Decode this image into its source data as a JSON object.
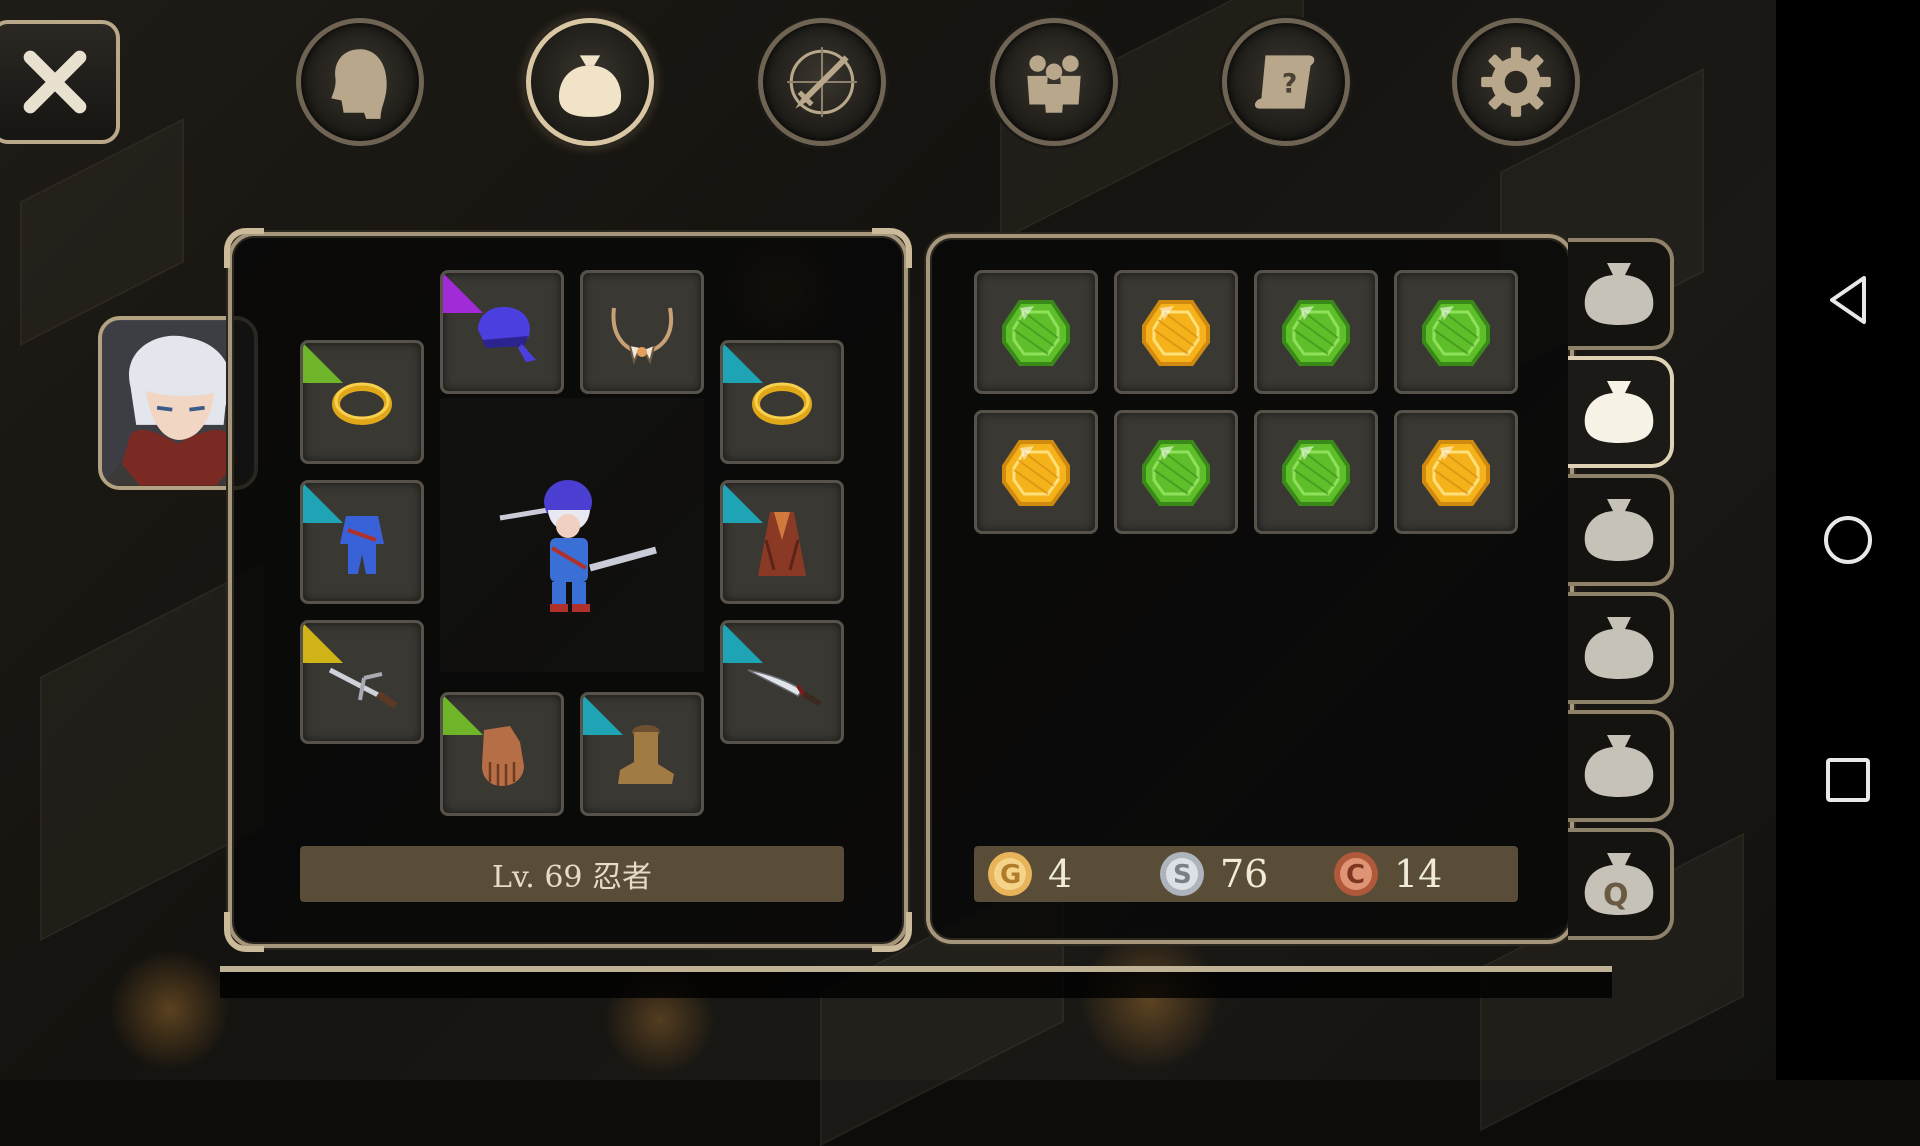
{
  "top_tabs": [
    {
      "name": "character",
      "icon": "head-icon",
      "active": false
    },
    {
      "name": "inventory",
      "icon": "bag-icon",
      "active": true
    },
    {
      "name": "skills",
      "icon": "compass-sword-icon",
      "active": false
    },
    {
      "name": "party",
      "icon": "group-icon",
      "active": false
    },
    {
      "name": "quests",
      "icon": "scroll-icon",
      "active": false
    },
    {
      "name": "settings",
      "icon": "gear-icon",
      "active": false
    }
  ],
  "equipment": {
    "class_label": "Lv. 69 忍者",
    "slots": [
      {
        "slot": "head",
        "item": "bandana-icon",
        "rarity_color": "#a12bd6"
      },
      {
        "slot": "neck",
        "item": "fang-necklace-icon",
        "rarity_color": null
      },
      {
        "slot": "ring-left",
        "item": "gold-ring-icon",
        "rarity_color": "#6fb52a"
      },
      {
        "slot": "ring-right",
        "item": "gold-ring-icon",
        "rarity_color": "#1fa4b5"
      },
      {
        "slot": "body",
        "item": "ninja-suit-icon",
        "rarity_color": "#1fa4b5"
      },
      {
        "slot": "cloak",
        "item": "cloak-icon",
        "rarity_color": "#1fa4b5"
      },
      {
        "slot": "main-hand",
        "item": "sai-icon",
        "rarity_color": "#d0b317"
      },
      {
        "slot": "off-hand",
        "item": "dagger-icon",
        "rarity_color": "#1fa4b5"
      },
      {
        "slot": "hands",
        "item": "glove-icon",
        "rarity_color": "#6fb52a"
      },
      {
        "slot": "feet",
        "item": "boot-icon",
        "rarity_color": "#1fa4b5"
      }
    ]
  },
  "inventory": {
    "items": [
      {
        "item": "green-gem-icon",
        "color": "#5fbf2a"
      },
      {
        "item": "gold-gem-icon",
        "color": "#f5b21a"
      },
      {
        "item": "green-gem-icon",
        "color": "#5fbf2a"
      },
      {
        "item": "green-gem-icon",
        "color": "#5fbf2a"
      },
      {
        "item": "gold-gem-icon",
        "color": "#f5b21a"
      },
      {
        "item": "green-gem-icon",
        "color": "#5fbf2a"
      },
      {
        "item": "green-gem-icon",
        "color": "#5fbf2a"
      },
      {
        "item": "gold-gem-icon",
        "color": "#f5b21a"
      }
    ],
    "bag_tabs": [
      {
        "label": "bag-1",
        "active": false
      },
      {
        "label": "bag-2",
        "active": true
      },
      {
        "label": "bag-3",
        "active": false
      },
      {
        "label": "bag-4",
        "active": false
      },
      {
        "label": "bag-5",
        "active": false
      },
      {
        "label": "Q",
        "active": false
      }
    ]
  },
  "currency": {
    "gold": {
      "symbol": "G",
      "value": "4"
    },
    "silver": {
      "symbol": "S",
      "value": "76"
    },
    "copper": {
      "symbol": "C",
      "value": "14"
    }
  },
  "colors": {
    "panel_border": "#a6977c",
    "bar_bg": "#5a4d38",
    "accent": "#e0d2b4"
  }
}
